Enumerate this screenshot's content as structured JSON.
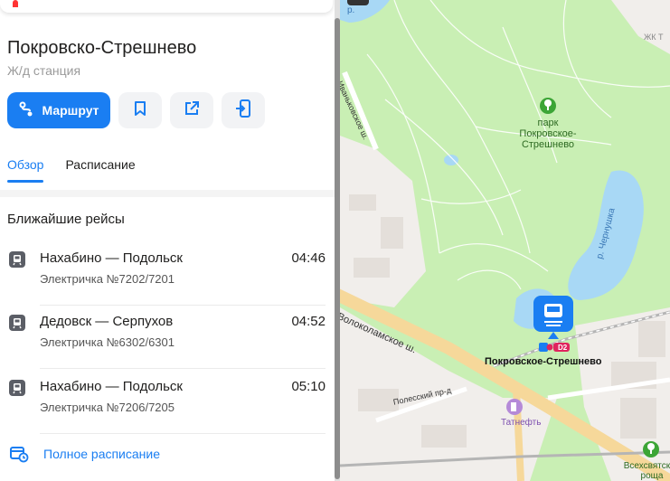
{
  "place": {
    "title": "Покровско-Стрешнево",
    "subtitle": "Ж/д станция"
  },
  "actions": {
    "route_label": "Маршрут",
    "icons": [
      "route-icon",
      "bookmark-icon",
      "share-icon",
      "send-to-phone-icon"
    ]
  },
  "tabs": [
    {
      "label": "Обзор",
      "active": true
    },
    {
      "label": "Расписание",
      "active": false
    }
  ],
  "departures": {
    "title": "Ближайшие рейсы",
    "items": [
      {
        "route": "Нахабино — Подольск",
        "train": "Электричка №7202/7201",
        "time": "04:46"
      },
      {
        "route": "Дедовск — Серпухов",
        "train": "Электричка №6302/6301",
        "time": "04:52"
      },
      {
        "route": "Нахабино — Подольск",
        "train": "Электричка №7206/7205",
        "time": "05:10"
      }
    ],
    "full_schedule_label": "Полное расписание"
  },
  "map": {
    "labels": {
      "park": "парк\nПокровское-\nСтрешнево",
      "station": "Покровское-Стрешнево",
      "station_badge": "D2",
      "volokolamskoe": "Волоколамское ш.",
      "ivankovskoe": "Иваньковское ш.",
      "cheryomushka": "р. Чернушка",
      "polessky": "Полесский пр-д",
      "tatneft": "Татнефть",
      "vsekhsvyatskaya": "Всехсвятская\nроща",
      "zhk": "ЖК Т",
      "river_top": "р."
    },
    "colors": {
      "park": "#c9efb4",
      "water": "#a8d8f5",
      "road": "#f6d89a",
      "urban": "#f1eeeb",
      "accent": "#1a7ef2"
    }
  }
}
